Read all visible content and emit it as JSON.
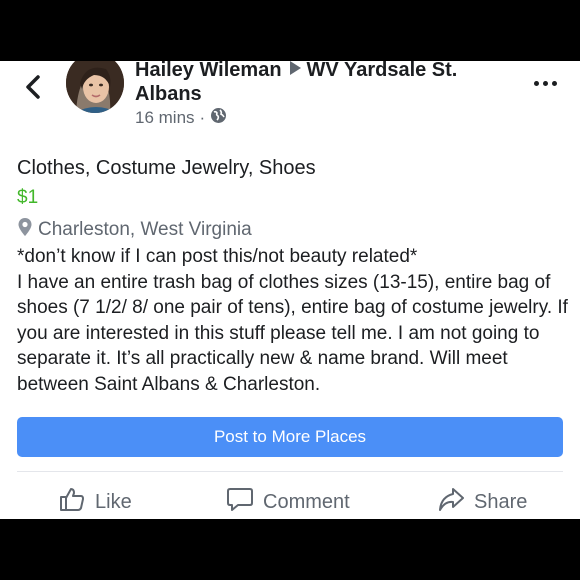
{
  "post": {
    "author": "Hailey Wileman",
    "group": "WV Yardsale St. Albans",
    "time": "16 mins"
  },
  "listing": {
    "title": "Clothes, Costume Jewelry, Shoes",
    "price": "$1",
    "location": "Charleston, West Virginia",
    "description": "*don’t know if I can post this/not beauty related*\nI have an entire trash bag of clothes sizes (13-15), entire bag of shoes (7 1/2/ 8/ one pair of tens), entire bag of costume jewelry. If you are interested in this stuff please tell me. I am not going to separate it. It’s all practically new & name brand. Will meet between Saint Albans & Charleston."
  },
  "buttons": {
    "post_more": "Post to More Places"
  },
  "actions": {
    "like": "Like",
    "comment": "Comment",
    "share": "Share"
  },
  "colors": {
    "button_blue": "#4b8ff7",
    "price_green": "#42b72a"
  },
  "icons": [
    "back-chevron-icon",
    "more-options-icon",
    "globe-icon",
    "location-pin-icon",
    "thumbs-up-icon",
    "comment-bubble-icon",
    "share-arrow-icon"
  ]
}
